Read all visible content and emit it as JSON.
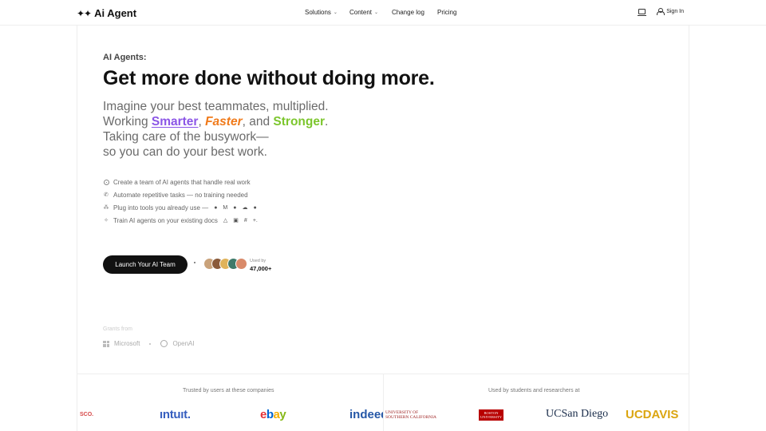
{
  "nav": {
    "logo_icon": "sparkles-icon",
    "logo_text": "Ai Agent",
    "links": [
      {
        "label": "Solutions",
        "has_dropdown": true
      },
      {
        "label": "Content",
        "has_dropdown": true
      },
      {
        "label": "Change log",
        "has_dropdown": false
      },
      {
        "label": "Pricing",
        "has_dropdown": false
      }
    ],
    "chevron": "⌄",
    "sign_in": "Sign In"
  },
  "hero": {
    "eyebrow": "AI Agents:",
    "headline": "Get more done without doing more.",
    "sub_line1": "Imagine your best teammates, multiplied.",
    "sub_working": "Working ",
    "sub_smarter": "Smarter",
    "sub_comma1": ", ",
    "sub_faster": "Faster",
    "sub_and": ", and ",
    "sub_stronger": "Stronger",
    "sub_period": ".",
    "sub_line3": "Taking care of the busywork—",
    "sub_line4": "so you can do your best work.",
    "features": [
      {
        "icon": "target-icon",
        "text": "Create a team of AI agents that handle real work"
      },
      {
        "icon": "phone-icon",
        "text": "Automate repetitive tasks — no training needed"
      },
      {
        "icon": "nodes-icon",
        "text": "Plug into tools you already use —"
      },
      {
        "icon": "sparkle-icon",
        "text": "Train AI agents on your existing docs"
      }
    ],
    "plus_more": "+.",
    "cta_label": "Launch Your AI Team",
    "used_by_label": "Used by",
    "used_by_count": "47,000+",
    "avatar_colors": [
      "#c9a27a",
      "#8a5a3a",
      "#e0b35a",
      "#3f7a6a",
      "#d98a6a"
    ],
    "grants_label": "Grants from",
    "grant_1": "Microsoft",
    "grant_2": "OpenAI"
  },
  "logos": {
    "left_title": "Trusted by users at these companies",
    "right_title": "Used by students and researchers at",
    "cisco": "SCO.",
    "intuit": "ıntuıt.",
    "ebay_e": "e",
    "ebay_b": "b",
    "ebay_a": "a",
    "ebay_y": "y",
    "indeed": "indeed",
    "usc_line1": "UNIVERSITY OF",
    "usc_line2": "SOUTHERN CALIFORNIA",
    "bu_line1": "BOSTON",
    "bu_line2": "UNIVERSITY",
    "ucsd": "UCSan Diego",
    "ucdavis": "UCDAVIS"
  }
}
